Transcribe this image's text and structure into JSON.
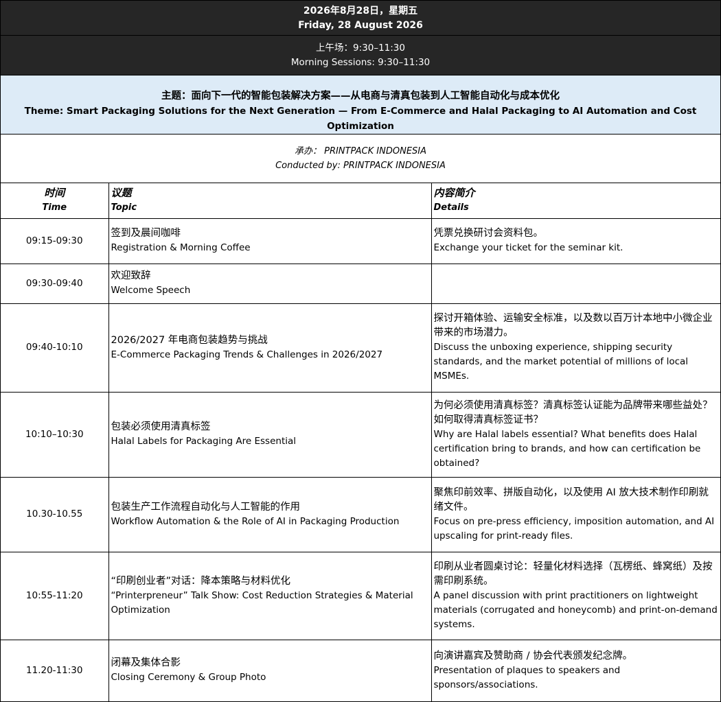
{
  "header": {
    "date_zh": "2026年8月28日，星期五",
    "date_en": "Friday, 28 August 2026",
    "session_zh": "上午场：9:30–11:30",
    "session_en": "Morning Sessions: 9:30–11:30",
    "theme_zh": "主题：面向下一代的智能包装解决方案——从电商与清真包装到人工智能自动化与成本优化",
    "theme_en": "Theme: Smart Packaging Solutions for the Next Generation — From E-Commerce and Halal Packaging to AI Automation and Cost Optimization",
    "organizer_zh": "承办：  PRINTPACK INDONESIA",
    "organizer_en": "Conducted by: PRINTPACK INDONESIA"
  },
  "table_headers": {
    "time_zh": "时间",
    "time_en": "Time",
    "topic_zh": "议题",
    "topic_en": "Topic",
    "details_zh": "内容简介",
    "details_en": "Details"
  },
  "rows": [
    {
      "time": "09:15-09:30",
      "topic_zh": "签到及晨间咖啡",
      "topic_en": "Registration & Morning Coffee",
      "details_zh": "凭票兑换研讨会资料包。",
      "details_en": "Exchange your ticket for the seminar kit."
    },
    {
      "time": "09:30-09:40",
      "topic_zh": "欢迎致辞",
      "topic_en": "Welcome Speech",
      "details_zh": "",
      "details_en": ""
    },
    {
      "time": "09:40-10:10",
      "topic_zh": "2026/2027 年电商包装趋势与挑战",
      "topic_en": "E-Commerce Packaging Trends & Challenges in 2026/2027",
      "details_zh": "探讨开箱体验、运输安全标准，以及数以百万计本地中小微企业带来的市场潜力。",
      "details_en": "Discuss the unboxing experience, shipping security standards, and the market potential of millions of local MSMEs."
    },
    {
      "time": "10:10–10:30",
      "topic_zh": "包装必须使用清真标签",
      "topic_en": "Halal Labels for Packaging Are Essential",
      "details_zh": "为何必须使用清真标签？清真标签认证能为品牌带来哪些益处？如何取得清真标签证书？",
      "details_en": "Why are Halal labels essential? What benefits does Halal certification bring to brands, and how can certification be obtained?"
    },
    {
      "time": "10.30-10.55",
      "topic_zh": "包装生产工作流程自动化与人工智能的作用",
      "topic_en": "Workflow Automation & the Role of AI in Packaging Production",
      "details_zh": "聚焦印前效率、拼版自动化，以及使用 AI 放大技术制作印刷就绪文件。",
      "details_en": "Focus on pre-press efficiency, imposition automation, and AI upscaling for print-ready files."
    },
    {
      "time": "10:55-11:20",
      "topic_zh": "“印刷创业者”对话：降本策略与材料优化",
      "topic_en": "“Printerpreneur” Talk Show: Cost Reduction Strategies & Material Optimization",
      "details_zh": "印刷从业者圆桌讨论：轻量化材料选择（瓦楞纸、蜂窝纸）及按需印刷系统。",
      "details_en": "A panel discussion with print practitioners on lightweight materials (corrugated and honeycomb) and print-on-demand systems."
    },
    {
      "time": "11.20-11:30",
      "topic_zh": "闭幕及集体合影",
      "topic_en": "Closing Ceremony & Group Photo",
      "details_zh": "向演讲嘉宾及赞助商 / 协会代表颁发纪念牌。",
      "details_en": "Presentation of plaques to speakers and sponsors/associations."
    }
  ],
  "colors": {
    "header_bg": "#262626",
    "theme_bg": "#ddebf7"
  }
}
